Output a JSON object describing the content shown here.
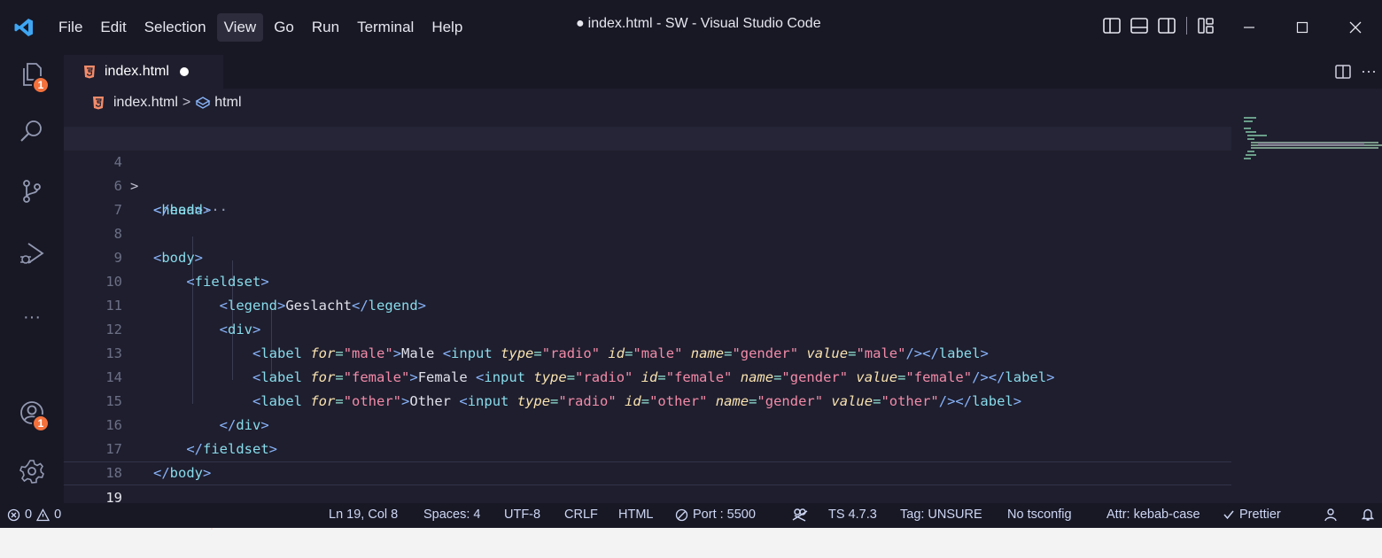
{
  "titlebar": {
    "menu": [
      "File",
      "Edit",
      "Selection",
      "View",
      "Go",
      "Run",
      "Terminal",
      "Help"
    ],
    "active_menu": "View",
    "title_dot": "●",
    "title": "index.html - SW - Visual Studio Code"
  },
  "activity_bar": {
    "explorer_badge": "1",
    "accounts_badge": "1",
    "more": "···"
  },
  "tab": {
    "name": "index.html",
    "modified": true,
    "more": "···"
  },
  "breadcrumb": {
    "file": "index.html",
    "separator": ">",
    "symbol": "html"
  },
  "editor": {
    "lines": [
      {
        "n": "4",
        "folded": true,
        "fold_more": "···"
      },
      {
        "n": "6"
      },
      {
        "n": "7"
      },
      {
        "n": "8"
      },
      {
        "n": "9"
      },
      {
        "n": "10",
        "legend_text": "Geslacht"
      },
      {
        "n": "11"
      },
      {
        "n": "12",
        "label_for": "\"male\"",
        "label_text": "Male ",
        "id": "\"male\"",
        "name": "\"gender\"",
        "value": "\"male\""
      },
      {
        "n": "13",
        "label_for": "\"female\"",
        "label_text": "Female ",
        "id": "\"female\"",
        "name": "\"gender\"",
        "value": "\"female\""
      },
      {
        "n": "14",
        "label_for": "\"other\"",
        "label_text": "Other ",
        "id": "\"other\"",
        "name": "\"gender\"",
        "value": "\"other\""
      },
      {
        "n": "15"
      },
      {
        "n": "16"
      },
      {
        "n": "17"
      },
      {
        "n": "18"
      },
      {
        "n": "19"
      }
    ],
    "current_line": "19",
    "input_type": "\"radio\""
  },
  "status": {
    "errors": "0",
    "warnings": "0",
    "position": "Ln 19, Col 8",
    "spaces": "Spaces: 4",
    "encoding": "UTF-8",
    "eol": "CRLF",
    "language": "HTML",
    "port": "Port : 5500",
    "ts_version": "TS 4.7.3",
    "tag": "Tag: UNSURE",
    "tsconfig": "No tsconfig",
    "attr": "Attr: kebab-case",
    "prettier": "Prettier"
  },
  "colors": {
    "background": "#1e1e2e",
    "chrome": "#181825",
    "tag": "#89dceb",
    "attribute": "#f9e2af",
    "string": "#f38ba8",
    "badge": "#f4713c"
  }
}
